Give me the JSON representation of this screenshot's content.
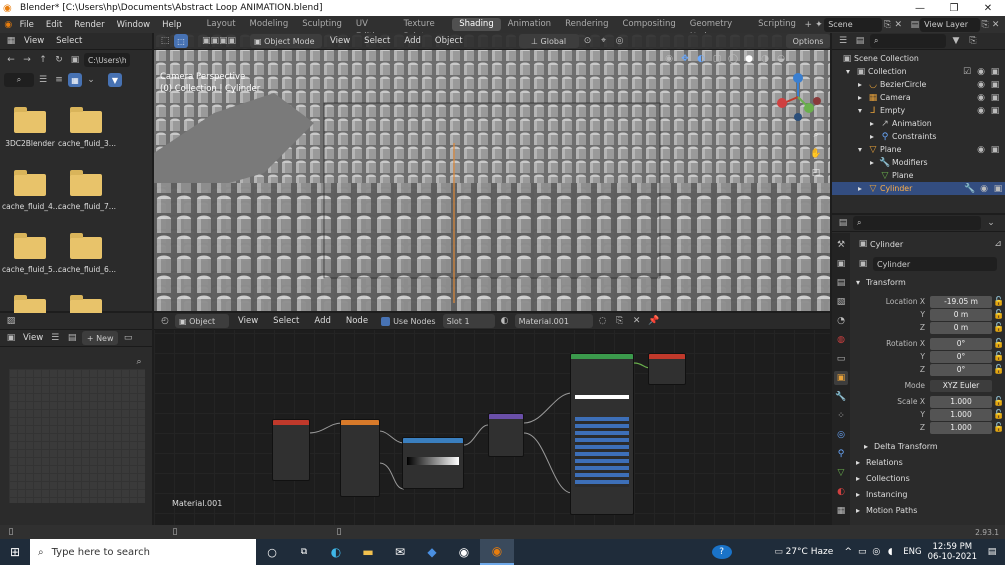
{
  "title_bar": {
    "text": "Blender* [C:\\Users\\hp\\Documents\\Abstract Loop ANIMATION.blend]"
  },
  "menu": [
    "File",
    "Edit",
    "Render",
    "Window",
    "Help"
  ],
  "workspace_tabs": [
    "Layout",
    "Modeling",
    "Sculpting",
    "UV Editing",
    "Texture Paint",
    "Shading",
    "Animation",
    "Rendering",
    "Compositing",
    "Geometry Nodes",
    "Scripting"
  ],
  "active_workspace": "Shading",
  "scene_name": "Scene",
  "view_layer": "View Layer",
  "file_browser": {
    "path": "C:\\Users\\h",
    "items": [
      "3DC2Blender",
      "cache_fluid_3...",
      "cache_fluid_4...",
      "cache_fluid_7...",
      "cache_fluid_5...",
      "cache_fluid_6..."
    ]
  },
  "viewport": {
    "mode": "Object Mode",
    "menus": [
      "View",
      "Select",
      "Add",
      "Object"
    ],
    "transform_orientation": "Global",
    "options_label": "Options",
    "overlay_title": "Camera Perspective",
    "overlay_subtitle": "(0) Collection | Cylinder"
  },
  "image_editor": {
    "view_label": "View",
    "new_label": "New"
  },
  "node_editor": {
    "object_label": "Object",
    "menus": [
      "View",
      "Select",
      "Add",
      "Node"
    ],
    "use_nodes_label": "Use Nodes",
    "slot": "Slot 1",
    "material": "Material.001",
    "footer_material": "Material.001"
  },
  "outliner": {
    "root": "Scene Collection",
    "rows": [
      {
        "label": "Collection",
        "indent": 1
      },
      {
        "label": "BezierCircle",
        "indent": 2
      },
      {
        "label": "Camera",
        "indent": 2
      },
      {
        "label": "Empty",
        "indent": 2
      },
      {
        "label": "Animation",
        "indent": 3
      },
      {
        "label": "Constraints",
        "indent": 3
      },
      {
        "label": "Plane",
        "indent": 2
      },
      {
        "label": "Modifiers",
        "indent": 3
      },
      {
        "label": "Plane",
        "indent": 3
      },
      {
        "label": "Cylinder",
        "indent": 2,
        "selected": true
      }
    ]
  },
  "properties": {
    "object_name": "Cylinder",
    "data_name": "Cylinder",
    "transform_label": "Transform",
    "location_label": "Location X",
    "location": [
      "-19.05 m",
      "0 m",
      "0 m"
    ],
    "rotation_label": "Rotation X",
    "rotation": [
      "0°",
      "0°",
      "0°"
    ],
    "mode_label": "Mode",
    "mode_value": "XYZ Euler",
    "scale_label": "Scale X",
    "scale": [
      "1.000",
      "1.000",
      "1.000"
    ],
    "axis_y": "Y",
    "axis_z": "Z",
    "sections": [
      "Delta Transform",
      "Relations",
      "Collections",
      "Instancing",
      "Motion Paths"
    ]
  },
  "version": "2.93.1",
  "taskbar": {
    "search_placeholder": "Type here to search",
    "weather": "27°C Haze",
    "lang": "ENG",
    "time": "12:59 PM",
    "date": "06-10-2021"
  },
  "colors": {
    "accent": "#4772b3",
    "selected_row": "#334d80",
    "folder": "#e8c36a"
  }
}
